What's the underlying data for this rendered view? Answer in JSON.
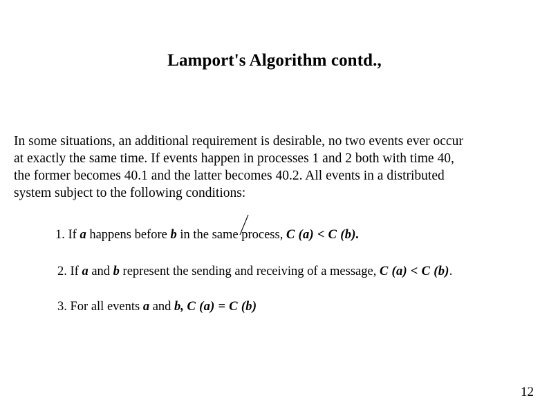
{
  "slide": {
    "title": "Lamport's Algorithm contd.,",
    "page_number": "12",
    "background_color": "#ffffff",
    "text_color": "#000000"
  },
  "body": {
    "lines": [
      "In some situations, an additional requirement is desirable, no two events ever occur",
      "at exactly the same time.  If events happen in processes 1 and 2 both with time 40,",
      "the former becomes 40.1 and the latter becomes 40.2.  All events in a distributed",
      "system subject to the following conditions:"
    ]
  },
  "conditions": [
    {
      "number": "1.",
      "text_before_a": "If ",
      "var_a": "a",
      "text_mid": " happens before ",
      "var_b": "b",
      "text_after": " in the same process, ",
      "expression": "C (a) < C (b).",
      "trailing": ""
    },
    {
      "number": "2.",
      "text_before_a": "If ",
      "var_a": "a",
      "text_mid": " and ",
      "var_b": "b",
      "text_after": " represent the sending and receiving of a message,  ",
      "expression": "C (a) < C (b)",
      "trailing": "."
    },
    {
      "number": "3.",
      "text_before_a": "For all events ",
      "var_a": "a",
      "text_mid": " and ",
      "var_b": "b,",
      "text_after": "  ",
      "expression": "C (a) = C (b)",
      "trailing": ""
    }
  ],
  "annotations": {
    "slash_mark": "diagonal-slash-stroke"
  }
}
